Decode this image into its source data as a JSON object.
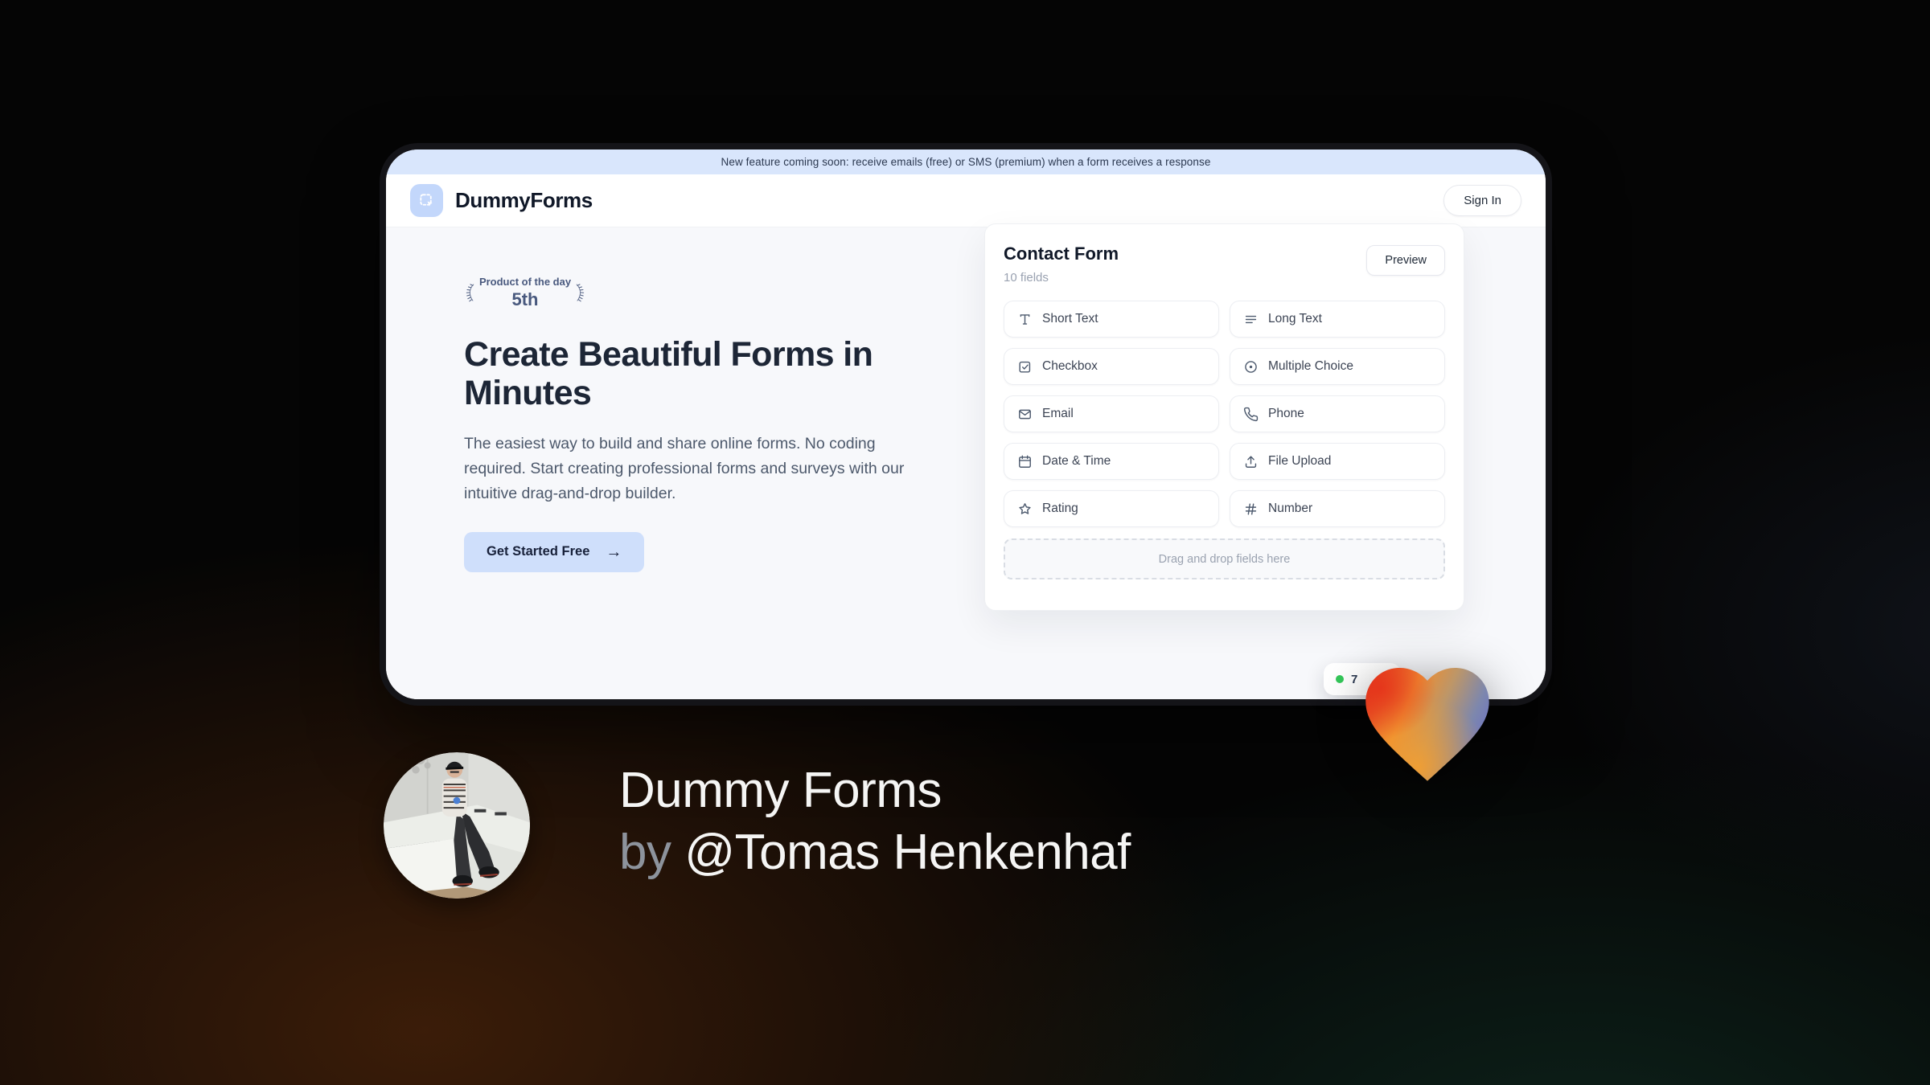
{
  "banner": {
    "text": "New feature coming soon: receive emails (free) or SMS (premium) when a form receives a response"
  },
  "header": {
    "brand": "DummyForms",
    "sign_in_label": "Sign In"
  },
  "hero": {
    "award": {
      "title": "Product of the day",
      "rank": "5th"
    },
    "headline": "Create Beautiful Forms in Minutes",
    "description": "The easiest way to build and share online forms. No coding required. Start creating professional forms and surveys with our intuitive drag-and-drop builder.",
    "cta_label": "Get Started Free",
    "cta_arrow": "→"
  },
  "form_builder": {
    "title": "Contact Form",
    "subtitle": "10 fields",
    "preview_label": "Preview",
    "fields": [
      {
        "label": "Short Text",
        "icon": "text-icon"
      },
      {
        "label": "Long Text",
        "icon": "lines-icon"
      },
      {
        "label": "Checkbox",
        "icon": "checkbox-icon"
      },
      {
        "label": "Multiple Choice",
        "icon": "radio-icon"
      },
      {
        "label": "Email",
        "icon": "envelope-icon"
      },
      {
        "label": "Phone",
        "icon": "phone-icon"
      },
      {
        "label": "Date & Time",
        "icon": "calendar-icon"
      },
      {
        "label": "File Upload",
        "icon": "upload-icon"
      },
      {
        "label": "Rating",
        "icon": "star-icon"
      },
      {
        "label": "Number",
        "icon": "hash-icon"
      }
    ],
    "dropzone_text": "Drag and drop fields here",
    "status_badge": {
      "text": "7",
      "dot_color": "#34c759"
    }
  },
  "footer": {
    "line1": "Dummy Forms",
    "line2_prefix": "by ",
    "line2_handle": "@Tomas Henkenhaf"
  },
  "colors": {
    "banner_bg": "#d9e6fc",
    "accent_button_bg": "#cfdffb",
    "logo_bg": "#c3d7fb",
    "status_green": "#34c759",
    "heart_red": "#e23b1e",
    "heart_orange": "#ee8e31",
    "heart_blue": "#6f75c1"
  }
}
